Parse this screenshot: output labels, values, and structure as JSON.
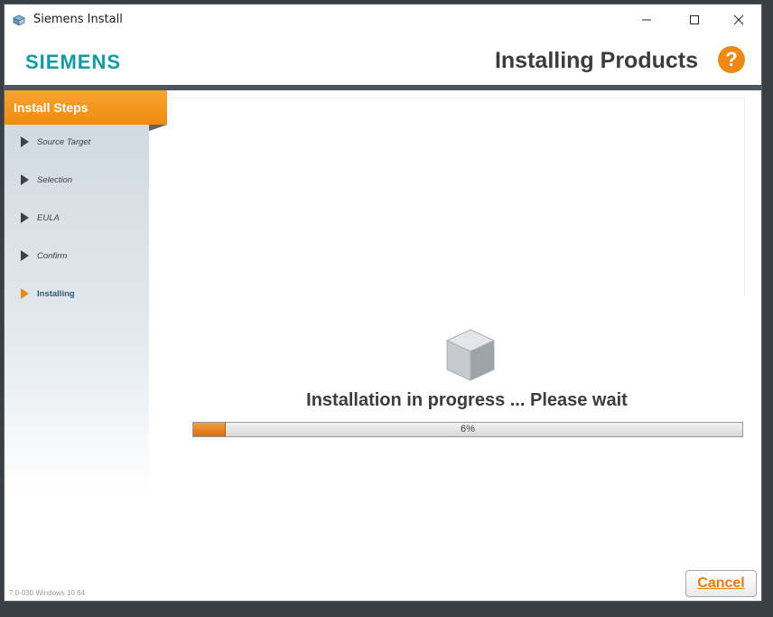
{
  "window": {
    "title": "Siemens Install",
    "logo": "SIEMENS",
    "page_title": "Installing Products",
    "help_icon": "question-icon"
  },
  "sidebar": {
    "header": "Install Steps",
    "items": [
      {
        "label": "Source Target",
        "active": false
      },
      {
        "label": "Selection",
        "active": false
      },
      {
        "label": "EULA",
        "active": false
      },
      {
        "label": "Confirm",
        "active": false
      },
      {
        "label": "Installing",
        "active": true
      }
    ]
  },
  "main": {
    "message": "Installation in progress ... Please wait",
    "progress_percent": 6,
    "progress_label": "6%"
  },
  "footer": {
    "version": "7.0-030  Windows 10 64",
    "cancel_label": "Cancel"
  },
  "colors": {
    "brand": "#139aa3",
    "accent": "#ee8a14",
    "header_bar": "#4b5660"
  }
}
